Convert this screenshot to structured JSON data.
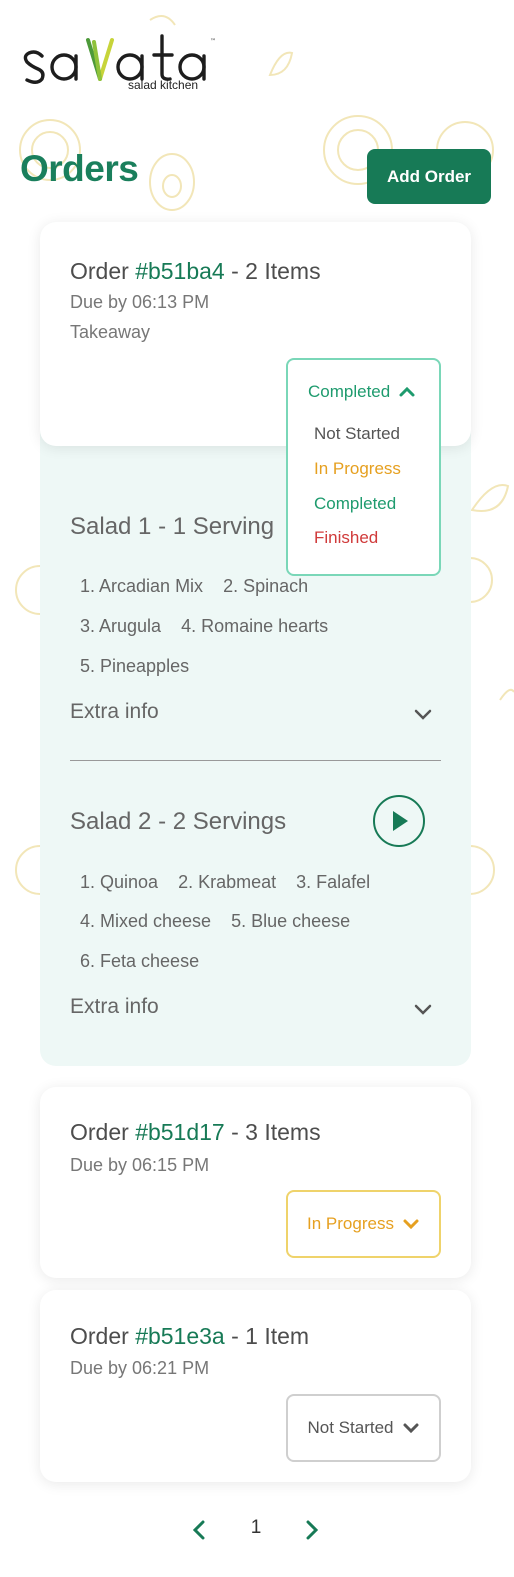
{
  "brand": {
    "logo_text": "salata",
    "tagline": "salad kitchen",
    "trademark": "™",
    "accent": "#177a56"
  },
  "header": {
    "title": "Orders",
    "add_button": "Add Order"
  },
  "orders": [
    {
      "prefix": "Order ",
      "id": "#b51ba4",
      "items": " - 2 Items",
      "due": "Due by 06:13 PM",
      "mode": "Takeaway",
      "status": "Completed",
      "expanded": true,
      "dropdown_open": true,
      "salads": [
        {
          "title": "Salad 1 - 1 Serving",
          "ingredient_rows": [
            [
              "1. Arcadian Mix",
              "2. Spinach"
            ],
            [
              "3. Arugula",
              "4. Romaine hearts"
            ],
            [
              "5. Pineapples"
            ]
          ],
          "extra_label": "Extra info"
        },
        {
          "title": "Salad 2 - 2 Servings",
          "ingredient_rows": [
            [
              "1. Quinoa",
              "2. Krabmeat",
              "3. Falafel"
            ],
            [
              "4. Mixed cheese",
              "5. Blue cheese"
            ],
            [
              "6. Feta cheese"
            ]
          ],
          "extra_label": "Extra info"
        }
      ]
    },
    {
      "prefix": "Order ",
      "id": "#b51d17",
      "items": " - 3 Items",
      "due": "Due by 06:15 PM",
      "status": "In Progress"
    },
    {
      "prefix": "Order ",
      "id": "#b51e3a",
      "items": " - 1 Item",
      "due": "Due by 06:21 PM",
      "status": "Not Started"
    }
  ],
  "status_options": [
    {
      "label": "Not Started",
      "color": "#555555"
    },
    {
      "label": "In Progress",
      "color": "#e6a020"
    },
    {
      "label": "Completed",
      "color": "#1e9b6e"
    },
    {
      "label": "Finished",
      "color": "#d03a3a"
    }
  ],
  "status_colors": {
    "Completed": "#1e9b6e",
    "In Progress": "#e6a020",
    "Not Started": "#555555"
  },
  "pagination": {
    "current": "1"
  }
}
